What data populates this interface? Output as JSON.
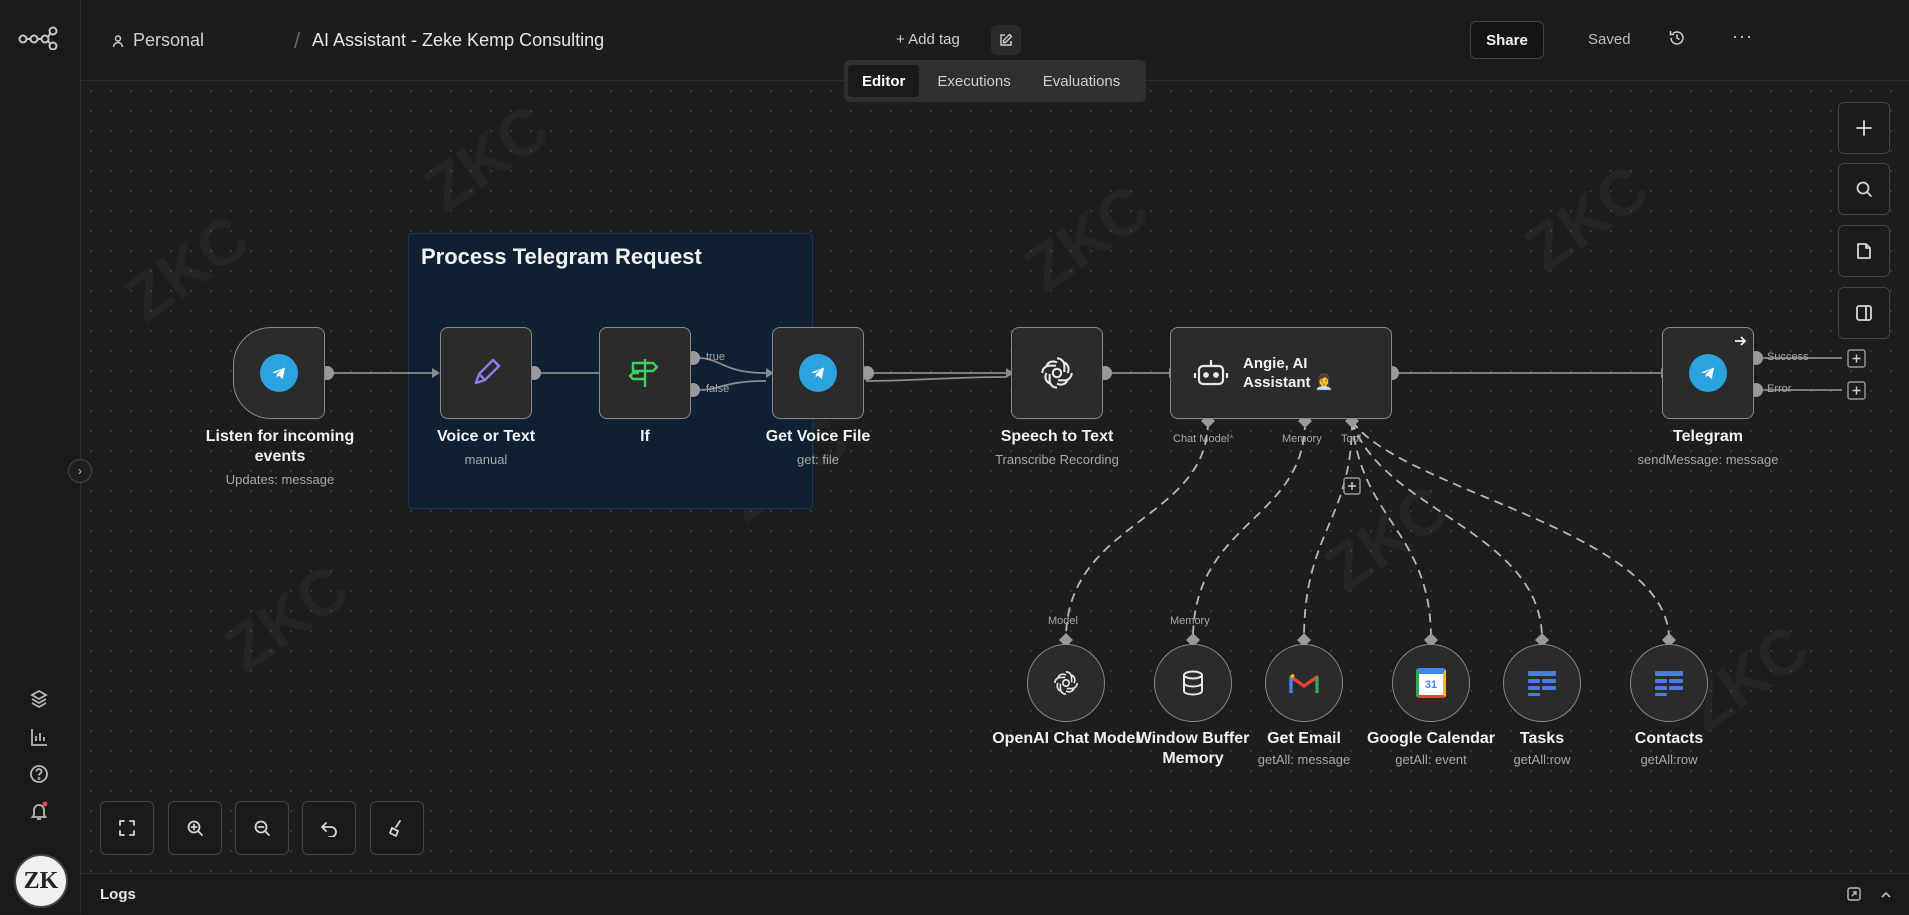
{
  "breadcrumb": {
    "workspace": "Personal",
    "separator": "/",
    "workflow_title": "AI Assistant - Zeke Kemp Consulting"
  },
  "header": {
    "add_tag": "+ Add tag",
    "share": "Share",
    "saved": "Saved",
    "more": "···"
  },
  "tabs": [
    {
      "label": "Editor",
      "active": true
    },
    {
      "label": "Executions",
      "active": false
    },
    {
      "label": "Evaluations",
      "active": false
    }
  ],
  "sticky_note": {
    "title": "Process Telegram Request",
    "color": "#0f2034"
  },
  "nodes": {
    "listen": {
      "label": "Listen for incoming events",
      "sub": "Updates: message"
    },
    "voice_or_text": {
      "label": "Voice or Text",
      "sub": "manual"
    },
    "if": {
      "label": "If",
      "true_port": "true",
      "false_port": "false"
    },
    "get_voice": {
      "label": "Get Voice File",
      "sub": "get: file"
    },
    "speech": {
      "label": "Speech to Text",
      "sub": "Transcribe Recording"
    },
    "agent": {
      "label": "Angie, AI Assistant 👩‍💼",
      "port_model": "Chat Model",
      "required_mark": "*",
      "port_memory": "Memory",
      "port_tool": "Tool"
    },
    "telegram": {
      "label": "Telegram",
      "sub": "sendMessage: message",
      "success_port": "Success",
      "error_port": "Error"
    }
  },
  "sub_nodes": {
    "openai": {
      "label": "OpenAI Chat Model",
      "port": "Model"
    },
    "memory": {
      "label": "Window Buffer Memory",
      "port": "Memory"
    },
    "email": {
      "label": "Get Email",
      "sub": "getAll: message"
    },
    "calendar": {
      "label": "Google Calendar",
      "sub": "getAll: event",
      "day": "31"
    },
    "tasks": {
      "label": "Tasks",
      "sub": "getAll:row"
    },
    "contacts": {
      "label": "Contacts",
      "sub": "getAll:row"
    }
  },
  "watermark_text": "ZKC",
  "avatar_text": "ZK",
  "logs": {
    "label": "Logs"
  },
  "colors": {
    "telegram": "#2aa3df",
    "pencil": "#8b7fe8",
    "if_green": "#3ecf5c",
    "sticky_border": "#1e3550",
    "sheets_blue": "#4a7be0"
  }
}
